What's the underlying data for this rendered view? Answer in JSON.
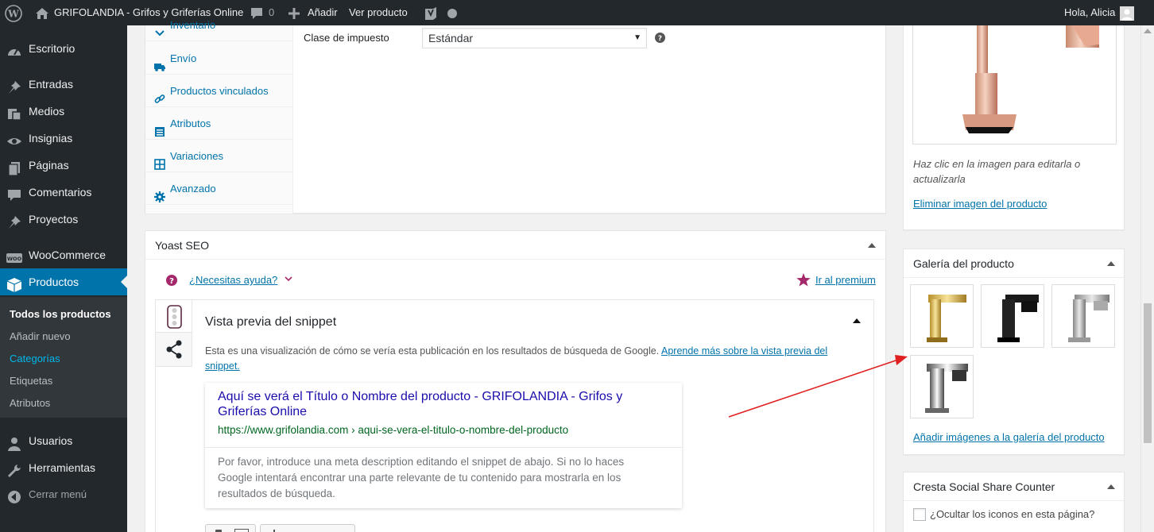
{
  "adminbar": {
    "site_name": "GRIFOLANDIA - Grifos y Griferías Online",
    "comments_count": "0",
    "add_new": "Añadir",
    "view_product": "Ver producto",
    "greeting": "Hola, Alicia"
  },
  "menu": {
    "escritorio": "Escritorio",
    "entradas": "Entradas",
    "medios": "Medios",
    "insignias": "Insignias",
    "paginas": "Páginas",
    "comentarios": "Comentarios",
    "proyectos": "Proyectos",
    "woocommerce": "WooCommerce",
    "productos": "Productos",
    "usuarios": "Usuarios",
    "herramientas": "Herramientas",
    "cerrar": "Cerrar menú",
    "woo_badge": "WOO"
  },
  "submenu": {
    "todos": "Todos los productos",
    "anadir": "Añadir nuevo",
    "categorias": "Categorías",
    "etiquetas": "Etiquetas",
    "atributos": "Atributos"
  },
  "product_data": {
    "tabs": {
      "inventario": "Inventario",
      "envio": "Envío",
      "vinculados": "Productos vinculados",
      "atributos": "Atributos",
      "variaciones": "Variaciones",
      "avanzado": "Avanzado"
    },
    "tax_class_label": "Clase de impuesto",
    "tax_class_value": "Estándar"
  },
  "yoast": {
    "title": "Yoast SEO",
    "help": "¿Necesitas ayuda?",
    "premium": "Ir al premium",
    "snippet_title": "Vista previa del snippet",
    "description": "Esta es una visualización de cómo se vería esta publicación en los resultados de búsqueda de Google.",
    "learn_more": "Aprende más sobre la vista previa del snippet.",
    "preview_title_line1": "Aquí se verá el Título o Nombre del producto - GRIFOLANDIA - Grifos y",
    "preview_title_line2": "Griferías Online",
    "preview_url": "https://www.grifolandia.com › aqui-se-vera-el-titulo-o-nombre-del-producto",
    "preview_desc_1": "Por favor, introduce una meta description editando el snippet de abajo. Si no lo haces",
    "preview_desc_2": "Google intentará encontrar una parte relevante de tu contenido para mostrarla en los",
    "preview_desc_3": "resultados de búsqueda."
  },
  "product_image": {
    "hint_line1": "Haz clic en la imagen para editarla o",
    "hint_line2": "actualizarla",
    "remove": "Eliminar imagen del producto"
  },
  "gallery": {
    "title": "Galería del producto",
    "add": "Añadir imágenes a la galería del producto",
    "items": [
      "gold-faucet",
      "black-faucet",
      "silver-faucet",
      "chrome-faucet"
    ]
  },
  "cresta": {
    "title": "Cresta Social Share Counter",
    "hide_icons": "¿Ocultar los iconos en esta página?"
  },
  "colors": {
    "adminbar": "#23282d",
    "accent": "#0073aa",
    "yoast": "#a4286a",
    "arrow": "#e02020"
  }
}
